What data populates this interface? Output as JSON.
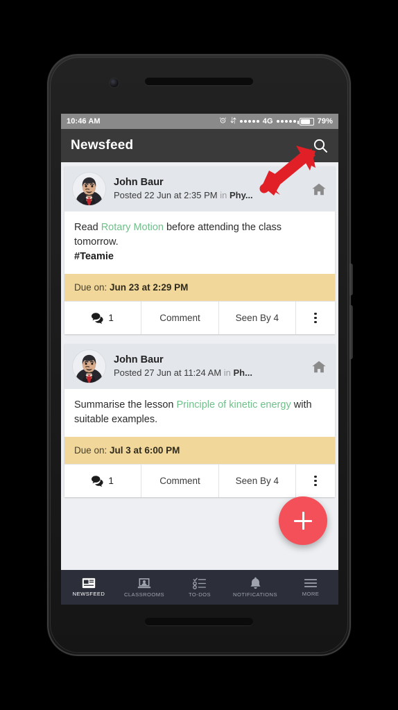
{
  "status_bar": {
    "time": "10:46 AM",
    "network": "4G",
    "battery_percent": "79%",
    "icons": [
      "alarm-icon",
      "data-transfer-icon",
      "signal-dots",
      "signal-dots-2",
      "battery-icon"
    ]
  },
  "app_bar": {
    "title": "Newsfeed",
    "search_icon": "search-icon"
  },
  "annotation": {
    "type": "arrow",
    "color": "#E01F26",
    "points_to": "search-icon"
  },
  "fab": {
    "label": "+",
    "color": "#F4505A",
    "name": "create-post-fab"
  },
  "posts": [
    {
      "author": "John Baur",
      "posted_prefix": "Posted 22 Jun at 2:35 PM",
      "in_word": " in ",
      "context": "Phy...",
      "header_icon": "home-icon",
      "body_prefix": "Read ",
      "body_link": "Rotary Motion",
      "body_suffix": " before attending the class tomorrow.",
      "hashtag": "#Teamie",
      "due_label": "Due on: ",
      "due_value": "Jun 23 at 2:29 PM",
      "comment_count": "1",
      "comment_label": "Comment",
      "seen_label": "Seen By 4",
      "overflow_icon": "kebab-menu-icon"
    },
    {
      "author": "John Baur",
      "posted_prefix": "Posted 27 Jun at 11:24 AM",
      "in_word": " in ",
      "context": "Ph...",
      "header_icon": "home-icon",
      "body_prefix": "Summarise the lesson ",
      "body_link": "Principle of kinetic energy",
      "body_suffix": "  with suitable examples.",
      "hashtag": "",
      "due_label": "Due on: ",
      "due_value": "Jul 3 at 6:00 PM",
      "comment_count": "1",
      "comment_label": "Comment",
      "seen_label": "Seen By 4",
      "overflow_icon": "kebab-menu-icon"
    }
  ],
  "bottom_nav": {
    "items": [
      {
        "label": "NEWSFEED",
        "icon": "newsfeed-icon",
        "active": true
      },
      {
        "label": "CLASSROOMS",
        "icon": "classrooms-icon",
        "active": false
      },
      {
        "label": "TO-DOS",
        "icon": "todos-icon",
        "active": false
      },
      {
        "label": "NOTIFICATIONS",
        "icon": "bell-icon",
        "active": false
      },
      {
        "label": "MORE",
        "icon": "hamburger-icon",
        "active": false
      }
    ]
  },
  "colors": {
    "app_bar": "#3A3A3A",
    "status_bar": "#8A8A8A",
    "link_green": "#6FC08A",
    "due_amber": "#F2D79B",
    "nav_bar": "#2C2F3A",
    "accent_red": "#F4505A"
  }
}
